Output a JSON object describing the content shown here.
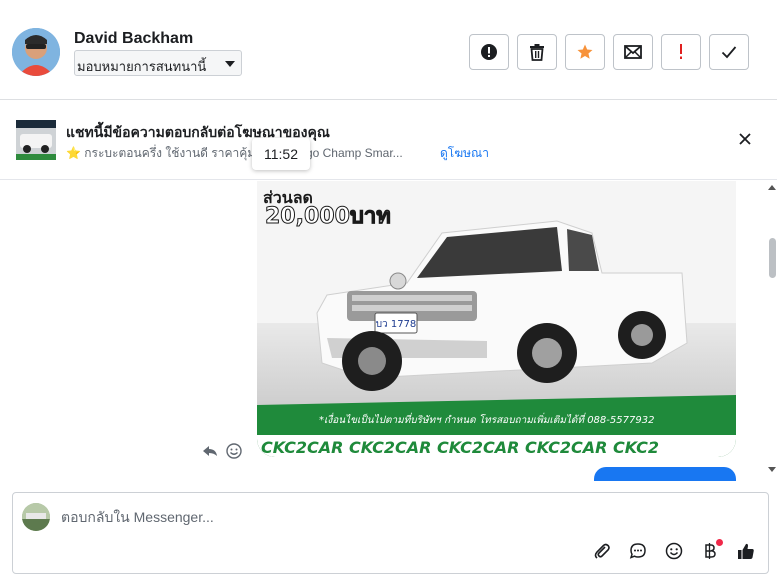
{
  "header": {
    "user_name": "David Backham",
    "assign_label": "มอบหมายการสนทนานี้",
    "actions": [
      {
        "name": "mark-spam",
        "icon": "exclamation-circle-icon"
      },
      {
        "name": "delete",
        "icon": "trash-icon"
      },
      {
        "name": "star",
        "icon": "star-icon"
      },
      {
        "name": "mark-unread",
        "icon": "envelope-icon"
      },
      {
        "name": "follow-up",
        "icon": "exclamation-icon"
      },
      {
        "name": "mark-done",
        "icon": "check-icon"
      }
    ],
    "star_color": "#f7923a",
    "followup_color": "#e02020"
  },
  "ad_banner": {
    "title": "แชทนี้มีข้อความตอบกลับต่อโฆษณาของคุณ",
    "subtitle_prefix": "⭐ กระบะตอนครึ่ง ใช้งานดี ราคาคุ้ม 🚗",
    "subtitle_ad": "lux Vigo Champ Smar...",
    "link": "ดูโฆษณา"
  },
  "tooltip": {
    "time": "11:52"
  },
  "message": {
    "promo_line1": "ส่วนลด",
    "promo_line2": "20,000บาท",
    "plate": "บว 1778",
    "footer_note": "*เงื่อนไขเป็นไปตามที่บริษัทฯ กำหนด โทรสอบถามเพิ่มเติมได้ที่ 088-5577932",
    "brand_strip": "CKC2CAR CKC2CAR CKC2CAR CKC2CAR CKC2"
  },
  "composer": {
    "placeholder": "ตอบกลับใน Messenger..."
  },
  "colors": {
    "accent": "#1877f2",
    "banner_green": "#1f8a3b"
  }
}
